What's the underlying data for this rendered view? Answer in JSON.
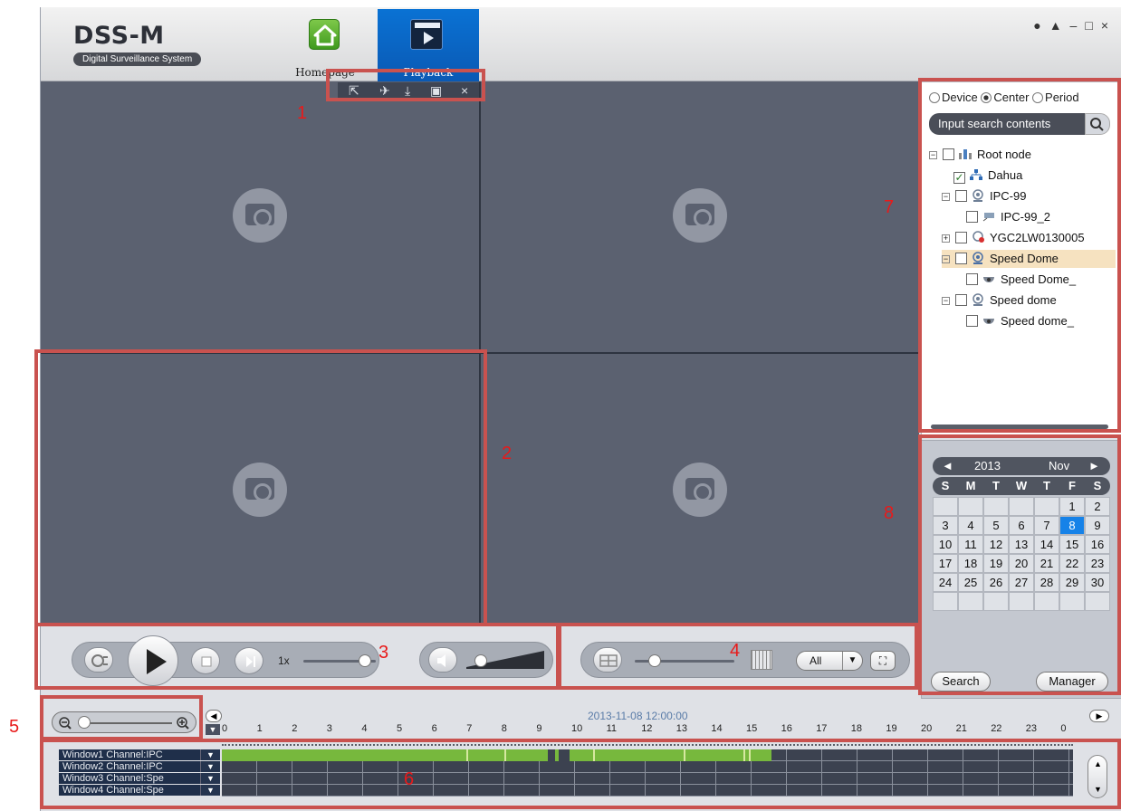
{
  "app": {
    "title": "DSS-M",
    "subtitle": "Digital Surveillance System",
    "window_controls": [
      "user-icon",
      "lock-icon",
      "minimize-icon",
      "maximize-icon",
      "close-icon"
    ]
  },
  "tabs": [
    {
      "label": "Homepage",
      "icon": "home-icon"
    },
    {
      "label": "Playback",
      "icon": "playback-icon",
      "active": true
    }
  ],
  "video_toolbar": {
    "icons": [
      "export-icon",
      "pin-icon",
      "download-icon",
      "snapshot-icon",
      "close-icon"
    ],
    "close_glyph": "×"
  },
  "device_panel": {
    "radio_options": [
      "Device",
      "Center",
      "Period"
    ],
    "selected": "Center",
    "search_placeholder": "Input search contents",
    "tree": [
      {
        "label": "Root node",
        "icon": "root-icon",
        "checked": false
      },
      {
        "label": "Dahua",
        "icon": "network-icon",
        "checked": true
      },
      {
        "label": "IPC-99",
        "icon": "camera-device-icon",
        "checked": false
      },
      {
        "label": "IPC-99_2",
        "icon": "ipc-camera-icon",
        "checked": false
      },
      {
        "label": "YGC2LW0130005",
        "icon": "camera-device-offline-icon",
        "checked": false
      },
      {
        "label": "Speed Dome",
        "icon": "camera-device-icon",
        "checked": false,
        "highlighted": true
      },
      {
        "label": "Speed Dome_",
        "icon": "dome-camera-icon",
        "checked": false
      },
      {
        "label": "Speed dome",
        "icon": "camera-device-icon",
        "checked": false
      },
      {
        "label": "Speed dome_",
        "icon": "dome-camera-icon",
        "checked": false
      }
    ]
  },
  "calendar": {
    "year": "2013",
    "month": "Nov",
    "weekdays": [
      "S",
      "M",
      "T",
      "W",
      "T",
      "F",
      "S"
    ],
    "days": [
      "",
      "",
      "",
      "",
      "",
      "1",
      "2",
      "3",
      "4",
      "5",
      "6",
      "7",
      "8",
      "9",
      "10",
      "11",
      "12",
      "13",
      "14",
      "15",
      "16",
      "17",
      "18",
      "19",
      "20",
      "21",
      "22",
      "23",
      "24",
      "25",
      "26",
      "27",
      "28",
      "29",
      "30",
      "",
      "",
      "",
      "",
      "",
      "",
      ""
    ],
    "selected_day": "8",
    "search_label": "Search",
    "manager_label": "Manager"
  },
  "playback": {
    "speed": "1x",
    "speed_level": 0.85,
    "volume_level": 0.1
  },
  "layout": {
    "filter": "All",
    "split_level": 0.2
  },
  "timeline": {
    "datetime": "2013-11-08 12:00:00",
    "hours": [
      "0",
      "1",
      "2",
      "3",
      "4",
      "5",
      "6",
      "7",
      "8",
      "9",
      "10",
      "11",
      "12",
      "13",
      "14",
      "15",
      "16",
      "17",
      "18",
      "19",
      "20",
      "21",
      "22",
      "23",
      "0"
    ],
    "channels": [
      "Window1 Channel:IPC",
      "Window2 Channel:IPC",
      "Window3 Channel:Spe",
      "Window4 Channel:Spe"
    ],
    "zoom_level": 0.05,
    "record_start_hour": 0,
    "record_end_hour": 15.5
  },
  "annotations": [
    "1",
    "2",
    "3",
    "4",
    "5",
    "6",
    "7",
    "8"
  ],
  "colors": {
    "accent_blue": "#0a66c6",
    "record_green": "#77b83d",
    "annotation_red": "#c9524f",
    "video_bg": "#5b6170"
  }
}
